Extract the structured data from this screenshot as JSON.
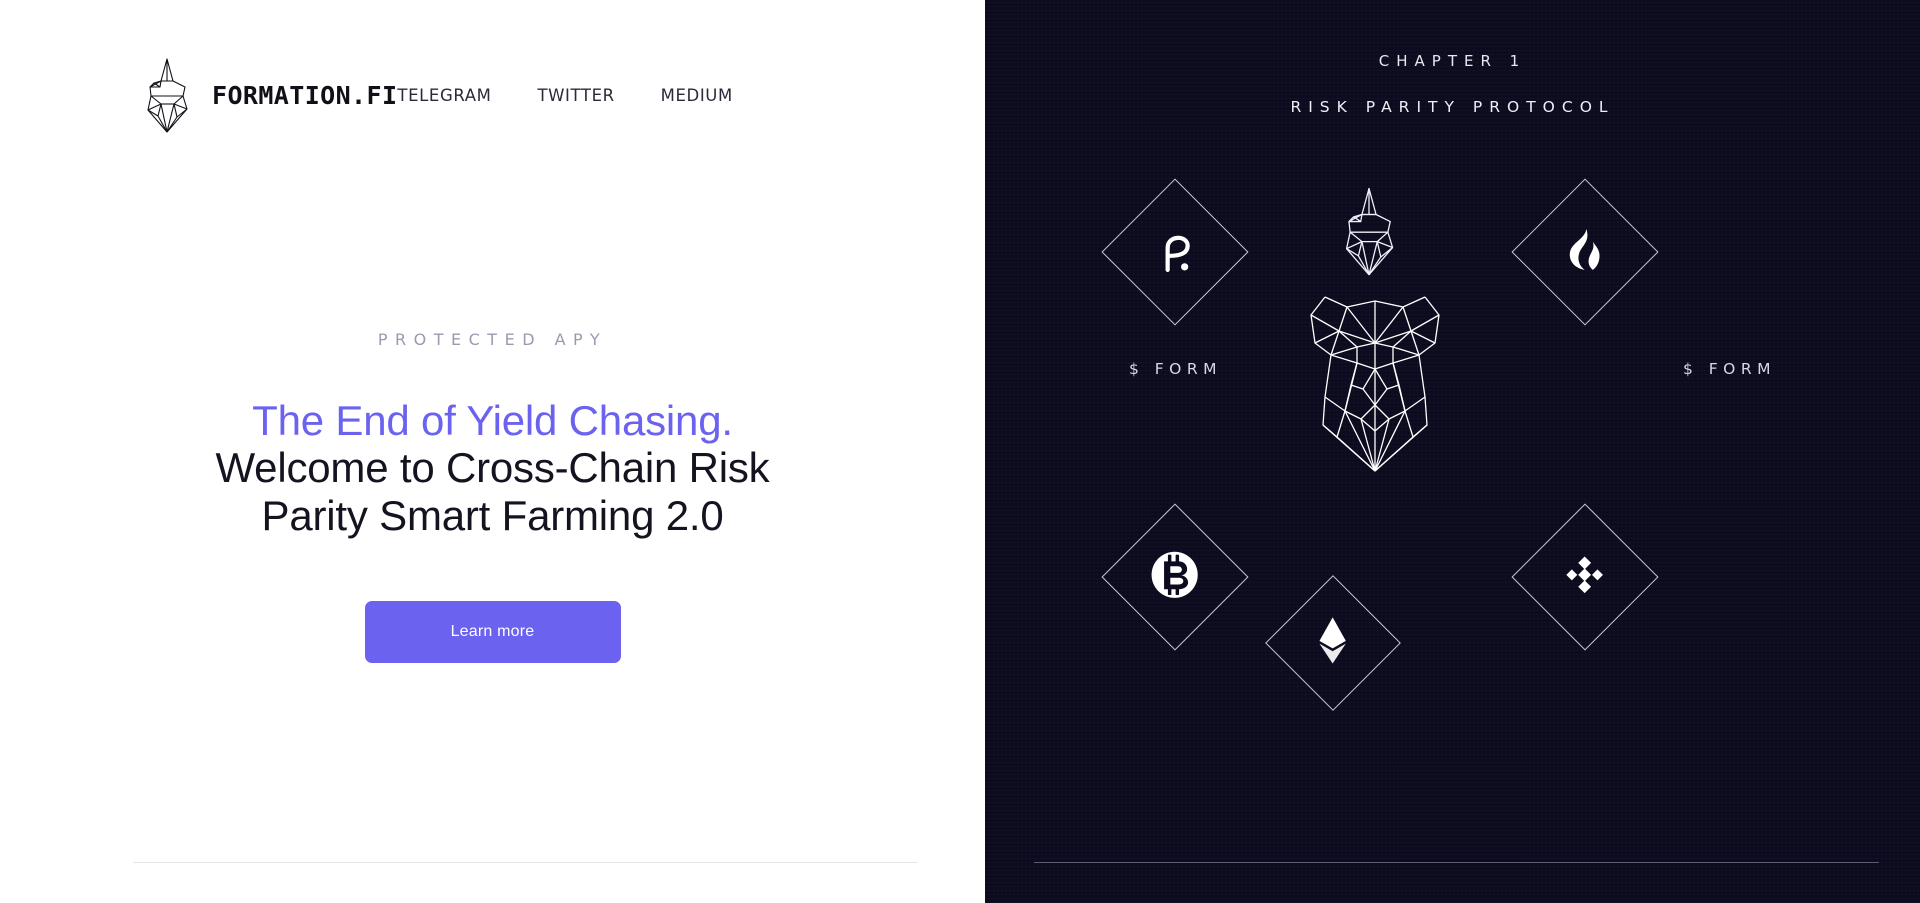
{
  "brand": {
    "name": "FORMATION.FI",
    "logo_icon": "iceberg-logo-icon"
  },
  "nav": {
    "items": [
      {
        "label": "TELEGRAM"
      },
      {
        "label": "TWITTER"
      },
      {
        "label": "MEDIUM"
      }
    ]
  },
  "hero": {
    "eyebrow": "PROTECTED APY",
    "title_accent": "The End of Yield Chasing.",
    "title_rest": "Welcome to Cross-Chain Risk Parity Smart Farming 2.0",
    "cta_label": "Learn more",
    "accent_color": "#6b62f0"
  },
  "showcase": {
    "chapter_label": "CHAPTER 1",
    "chapter_title": "RISK PARITY PROTOCOL",
    "background_color": "#0c0a1e",
    "center_icon": "bear-head-icon",
    "token_labels": [
      {
        "text": "$ FORM"
      },
      {
        "text": "$ FORM"
      }
    ],
    "nodes": [
      {
        "icon": "polkadot-icon",
        "position": "top-left"
      },
      {
        "icon": "iceberg-icon",
        "position": "top-center"
      },
      {
        "icon": "huobi-icon",
        "position": "top-right"
      },
      {
        "icon": "bitcoin-icon",
        "position": "bottom-left"
      },
      {
        "icon": "ethereum-icon",
        "position": "bottom-center"
      },
      {
        "icon": "binance-icon",
        "position": "bottom-right"
      }
    ]
  }
}
